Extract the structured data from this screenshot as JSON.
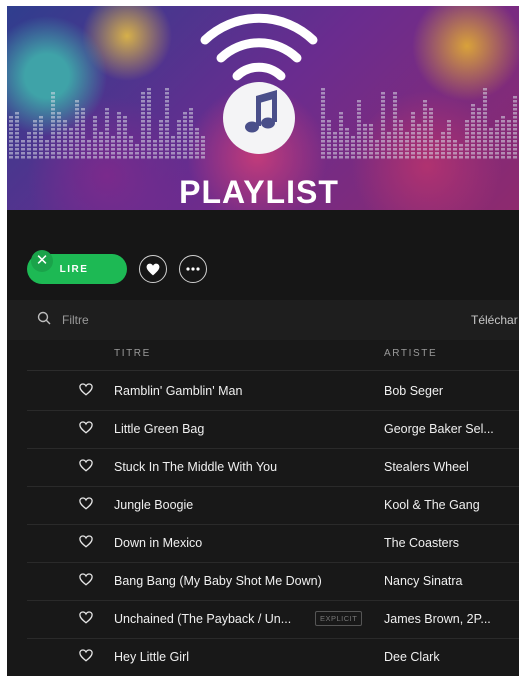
{
  "banner": {
    "title": "PLAYLIST"
  },
  "controls": {
    "play_label": "LIRE",
    "close_symbol": "✕"
  },
  "filter": {
    "placeholder": "Filtre",
    "download_label": "Téléchar"
  },
  "columns": {
    "title": "TITRE",
    "artist": "ARTISTE"
  },
  "tracks": [
    {
      "title": "Ramblin' Gamblin' Man",
      "artist": "Bob Seger"
    },
    {
      "title": "Little Green Bag",
      "artist": "George Baker Sel..."
    },
    {
      "title": "Stuck In The Middle With You",
      "artist": "Stealers Wheel"
    },
    {
      "title": "Jungle Boogie",
      "artist": "Kool & The Gang"
    },
    {
      "title": "Down in Mexico",
      "artist": "The Coasters"
    },
    {
      "title": "Bang Bang (My Baby Shot Me Down)",
      "artist": "Nancy Sinatra"
    },
    {
      "title": "Unchained (The Payback / Un...",
      "artist": "James Brown, 2P...",
      "explicit": "EXPLICIT"
    },
    {
      "title": "Hey Little Girl",
      "artist": "Dee Clark"
    }
  ],
  "colors": {
    "accent": "#1db954",
    "background": "#181818",
    "text": "#f0f0f0",
    "muted": "#9a9a9a"
  },
  "icons": [
    "wifi-icon",
    "music-note-icon",
    "close-icon",
    "heart-icon",
    "more-icon",
    "search-icon"
  ]
}
